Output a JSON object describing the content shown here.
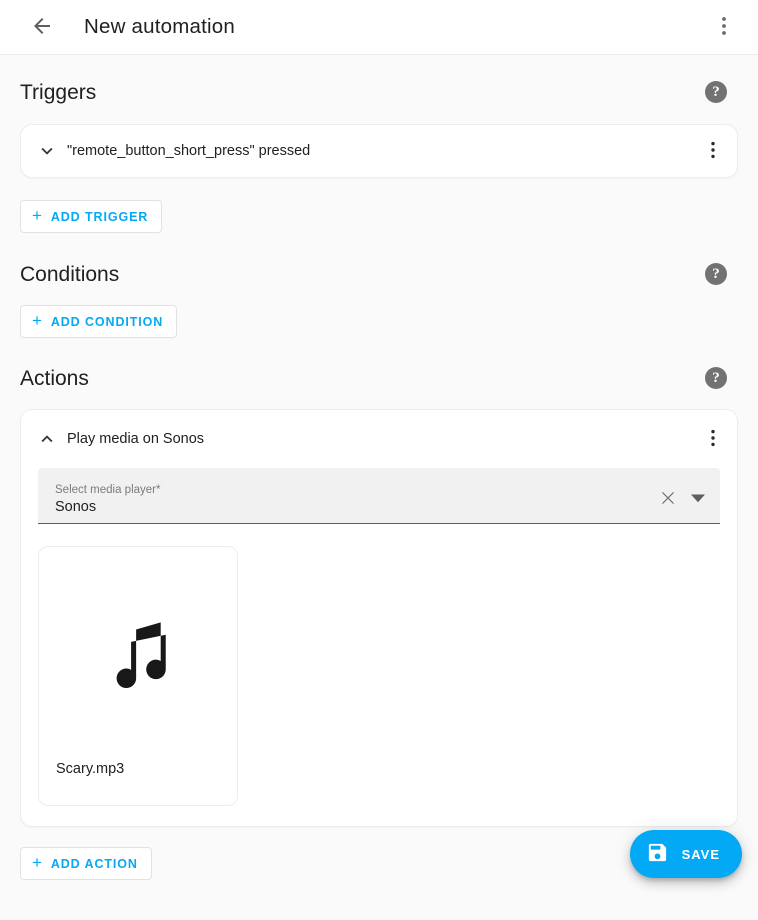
{
  "appbar": {
    "back_icon": "arrow-left-icon",
    "title": "New automation",
    "overflow_icon": "dots-vertical-icon"
  },
  "sections": {
    "triggers": {
      "title": "Triggers",
      "help_glyph": "?",
      "trigger": {
        "expand_icon": "chevron-down-icon",
        "label": "\"remote_button_short_press\" pressed",
        "overflow_icon": "dots-vertical-icon"
      },
      "add_button": {
        "plus": "+",
        "label": "ADD TRIGGER"
      }
    },
    "conditions": {
      "title": "Conditions",
      "help_glyph": "?",
      "add_button": {
        "plus": "+",
        "label": "ADD CONDITION"
      }
    },
    "actions": {
      "title": "Actions",
      "help_glyph": "?",
      "action": {
        "collapse_icon": "chevron-up-icon",
        "label": "Play media on Sonos",
        "overflow_icon": "dots-vertical-icon",
        "media_player_field": {
          "label": "Select media player*",
          "value": "Sonos",
          "clear_icon": "close-icon",
          "dropdown_icon": "menu-down-icon"
        },
        "media_item": {
          "icon": "music-note-icon",
          "caption": "Scary.mp3"
        }
      },
      "add_button": {
        "plus": "+",
        "label": "ADD ACTION"
      }
    }
  },
  "fab": {
    "icon": "content-save-icon",
    "label": "SAVE"
  },
  "colors": {
    "accent": "#03a9f4",
    "page_background": "#fafafa",
    "card_background": "#ffffff",
    "text_primary": "#212121",
    "text_secondary": "#7b7b7b",
    "help_circle": "#727272"
  }
}
